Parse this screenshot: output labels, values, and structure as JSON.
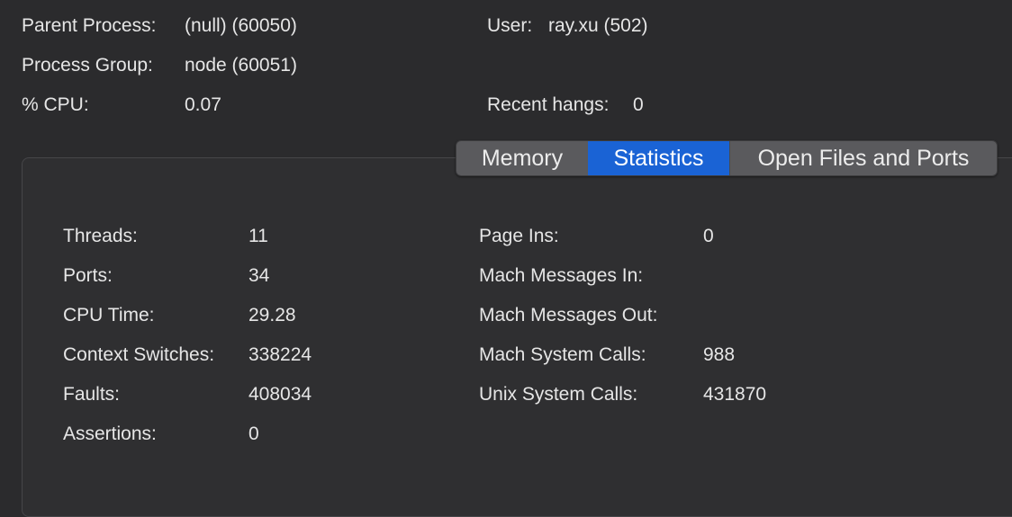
{
  "header": {
    "parent_process_label": "Parent Process:",
    "parent_process_value": "(null) (60050)",
    "user_label": "User:",
    "user_value": "ray.xu (502)",
    "process_group_label": "Process Group:",
    "process_group_value": "node (60051)",
    "cpu_label": "% CPU:",
    "cpu_value": "0.07",
    "recent_hangs_label": "Recent hangs:",
    "recent_hangs_value": "0"
  },
  "tabs": [
    {
      "label": "Memory",
      "selected": false
    },
    {
      "label": "Statistics",
      "selected": true
    },
    {
      "label": "Open Files and Ports",
      "selected": false
    }
  ],
  "stats_left": [
    {
      "label": "Threads:",
      "value": "11"
    },
    {
      "label": "Ports:",
      "value": "34"
    },
    {
      "label": "CPU Time:",
      "value": "29.28"
    },
    {
      "label": "Context Switches:",
      "value": "338224"
    },
    {
      "label": "Faults:",
      "value": "408034"
    },
    {
      "label": "Assertions:",
      "value": "0"
    }
  ],
  "stats_right": [
    {
      "label": "Page Ins:",
      "value": "0"
    },
    {
      "label": "Mach Messages In:",
      "value": ""
    },
    {
      "label": "Mach Messages Out:",
      "value": ""
    },
    {
      "label": "Mach System Calls:",
      "value": "988"
    },
    {
      "label": "Unix System Calls:",
      "value": "431870"
    }
  ],
  "colors": {
    "background": "#2b2b2d",
    "panel": "#2f2f31",
    "text": "#e6e6e6",
    "selected_tab": "#1a63d5"
  }
}
